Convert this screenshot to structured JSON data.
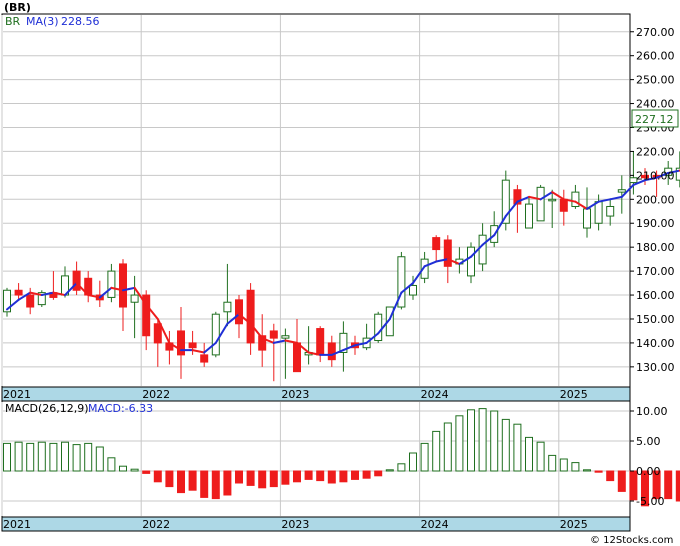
{
  "chart_data": [
    {
      "type": "candlestick",
      "ticker": "(BR)",
      "indicator_label": "BR",
      "ma_label": "MA(3)",
      "ma_value_text": "228.56",
      "last_price_text": "227.12",
      "ylim": [
        122,
        277
      ],
      "yticks": [
        130,
        140,
        150,
        160,
        170,
        180,
        190,
        200,
        210,
        220,
        230,
        240,
        250,
        260,
        270
      ],
      "ytick_labels": [
        "130.00",
        "140.00",
        "150.00",
        "160.00",
        "170.00",
        "180.00",
        "190.00",
        "200.00",
        "210.00",
        "220.00",
        "230.00",
        "240.00",
        "250.00",
        "260.00",
        "270.00"
      ],
      "x_labels": [
        "2021",
        "2022",
        "2023",
        "2024",
        "2025"
      ],
      "x_label_months": [
        0,
        12,
        24,
        36,
        48
      ],
      "months": [
        "2021-01",
        "2021-02",
        "2021-03",
        "2021-04",
        "2021-05",
        "2021-06",
        "2021-07",
        "2021-08",
        "2021-09",
        "2021-10",
        "2021-11",
        "2021-12",
        "2022-01",
        "2022-02",
        "2022-03",
        "2022-04",
        "2022-05",
        "2022-06",
        "2022-07",
        "2022-08",
        "2022-09",
        "2022-10",
        "2022-11",
        "2022-12",
        "2023-01",
        "2023-02",
        "2023-03",
        "2023-04",
        "2023-05",
        "2023-06",
        "2023-07",
        "2023-08",
        "2023-09",
        "2023-10",
        "2023-11",
        "2023-12",
        "2024-01",
        "2024-02",
        "2024-03",
        "2024-04",
        "2024-05",
        "2024-06",
        "2024-07",
        "2024-08",
        "2024-09",
        "2024-10",
        "2024-11",
        "2024-12",
        "2025-01",
        "2025-02",
        "2025-03",
        "2025-04",
        "2025-05",
        "2025-06",
        "2025-07",
        "2025-08",
        "2025-09",
        "2025-10",
        "2025-11",
        "2025-12"
      ],
      "ohlc": [
        [
          153,
          163,
          151,
          162
        ],
        [
          162,
          165,
          158,
          160
        ],
        [
          160,
          163,
          152,
          155
        ],
        [
          156,
          162,
          155,
          161
        ],
        [
          161,
          170,
          158,
          159
        ],
        [
          160,
          172,
          159,
          168
        ],
        [
          170,
          174,
          160,
          162
        ],
        [
          167,
          170,
          157,
          160
        ],
        [
          160,
          166,
          155,
          158
        ],
        [
          159,
          173,
          157,
          170
        ],
        [
          173,
          175,
          145,
          155
        ],
        [
          157,
          168,
          142,
          160
        ],
        [
          160,
          162,
          137,
          143
        ],
        [
          148,
          150,
          130,
          140
        ],
        [
          140,
          145,
          131,
          137
        ],
        [
          145,
          155,
          125,
          135
        ],
        [
          140,
          145,
          135,
          138
        ],
        [
          135,
          140,
          130,
          132
        ],
        [
          135,
          153,
          134,
          152
        ],
        [
          153,
          173,
          147,
          157
        ],
        [
          158,
          160,
          142,
          148
        ],
        [
          162,
          165,
          135,
          140
        ],
        [
          143,
          152,
          130,
          137
        ],
        [
          145,
          148,
          124,
          142
        ],
        [
          142,
          146,
          125,
          143
        ],
        [
          140,
          150,
          129,
          128
        ],
        [
          135,
          147,
          131,
          136
        ],
        [
          146,
          147,
          132,
          135
        ],
        [
          140,
          143,
          130,
          133
        ],
        [
          136,
          149,
          128,
          144
        ],
        [
          140,
          143,
          135,
          138
        ],
        [
          138,
          148,
          137,
          142
        ],
        [
          141,
          153,
          140,
          152
        ],
        [
          143,
          155,
          143,
          155
        ],
        [
          155,
          178,
          154,
          176
        ],
        [
          160,
          168,
          158,
          164
        ],
        [
          167,
          178,
          165,
          175
        ],
        [
          184,
          185,
          174,
          179
        ],
        [
          183,
          185,
          165,
          172
        ],
        [
          173,
          180,
          169,
          175
        ],
        [
          168,
          182,
          165,
          180
        ],
        [
          173,
          190,
          170,
          185
        ],
        [
          182,
          195,
          180,
          189
        ],
        [
          190,
          212,
          187,
          208
        ],
        [
          204,
          206,
          186,
          198
        ],
        [
          188,
          201,
          188,
          198
        ],
        [
          191,
          206,
          191,
          205
        ],
        [
          200,
          204,
          188,
          200
        ],
        [
          200,
          204,
          189,
          195
        ],
        [
          197,
          206,
          196,
          203
        ],
        [
          188,
          205,
          184,
          196
        ],
        [
          190,
          202,
          187,
          199
        ],
        [
          193,
          200,
          189,
          197
        ],
        [
          203,
          210,
          194,
          204
        ],
        [
          207,
          220,
          202,
          209
        ],
        [
          210,
          213,
          206,
          209
        ],
        [
          210,
          212,
          201,
          209
        ],
        [
          210,
          216,
          206,
          213
        ],
        [
          208,
          220,
          205,
          213
        ],
        [
          207,
          212,
          205,
          208
        ]
      ],
      "ma": [
        154,
        158,
        161,
        160,
        161,
        160,
        165,
        160,
        159,
        163,
        162,
        163,
        156,
        150,
        140,
        137,
        137,
        136,
        140,
        148,
        152,
        148,
        142,
        140,
        141,
        140,
        136,
        135,
        135,
        137,
        139,
        140,
        144,
        150,
        161,
        165,
        172,
        174,
        175,
        173,
        176,
        181,
        185,
        193,
        199,
        201,
        200,
        203,
        200,
        199,
        196,
        199,
        200,
        201,
        206,
        208,
        209,
        211,
        212,
        210
      ]
    },
    {
      "type": "bar",
      "title": "MACD(26,12,9)",
      "macd_value_text": "MACD:-6.33",
      "ylim": [
        -7.5,
        11.5
      ],
      "yticks": [
        -5,
        0,
        5,
        10
      ],
      "ytick_labels": [
        "-5.00",
        "0.00",
        "5.00",
        "10.00"
      ],
      "x_labels": [
        "2021",
        "2022",
        "2023",
        "2024",
        "2025"
      ],
      "values": [
        4.6,
        4.8,
        4.6,
        4.8,
        4.6,
        4.8,
        4.4,
        4.6,
        4.0,
        2.2,
        0.8,
        0.3,
        -0.4,
        -1.8,
        -2.6,
        -3.6,
        -3.2,
        -4.4,
        -4.6,
        -4.0,
        -2.0,
        -2.4,
        -2.8,
        -2.6,
        -2.2,
        -1.8,
        -1.4,
        -1.6,
        -2.0,
        -1.8,
        -1.4,
        -1.2,
        -0.8,
        0.2,
        1.2,
        3.0,
        4.6,
        6.6,
        8.0,
        9.2,
        10.2,
        10.4,
        10.0,
        8.6,
        7.8,
        5.6,
        4.8,
        2.6,
        2.0,
        1.4,
        0.2,
        -0.2,
        -1.6,
        -3.4,
        -4.8,
        -5.8,
        -4.6,
        -4.6,
        -5.0,
        -6.2
      ]
    }
  ],
  "watermark": "© 12Stocks.com",
  "colors": {
    "up": "#1f6f1f",
    "down": "#ee1c1c",
    "ma_up": "#1f2fd6",
    "ma_down": "#ee1c1c",
    "axis_band": "#add8e6",
    "grid": "#c8c8c8",
    "price_label_border": "#1f6f1f"
  }
}
